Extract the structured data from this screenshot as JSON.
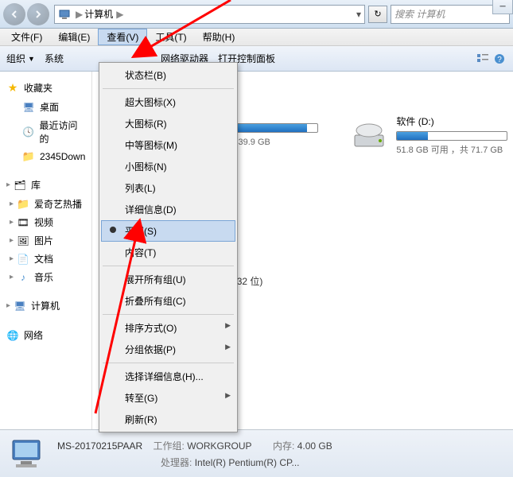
{
  "address": {
    "location": "计算机",
    "sep": "▶"
  },
  "search": {
    "placeholder": "搜索 计算机"
  },
  "menubar": {
    "file": "文件(F)",
    "edit": "编辑(E)",
    "view": "查看(V)",
    "tools": "工具(T)",
    "help": "帮助(H)"
  },
  "toolbar": {
    "organize": "组织",
    "system": "系统",
    "map_drive": "网络驱动器",
    "control_panel": "打开控制面板"
  },
  "sidebar": {
    "favorites": "收藏夹",
    "fav_items": [
      "桌面",
      "最近访问的",
      "2345Down"
    ],
    "libraries": "库",
    "lib_items": [
      "爱奇艺热播",
      "视频",
      "图片",
      "文档",
      "音乐"
    ],
    "computer": "计算机",
    "network": "网络"
  },
  "dropdown": {
    "status_bar": "状态栏(B)",
    "extra_large": "超大图标(X)",
    "large": "大图标(R)",
    "medium": "中等图标(M)",
    "small": "小图标(N)",
    "list": "列表(L)",
    "details": "详细信息(D)",
    "tiles": "平铺(S)",
    "content": "内容(T)",
    "expand_all": "展开所有组(U)",
    "collapse_all": "折叠所有组(C)",
    "sort_by": "排序方式(O)",
    "group_by": "分组依据(P)",
    "choose_details": "选择详细信息(H)...",
    "goto": "转至(G)",
    "refresh": "刷新(R)"
  },
  "drives": [
    {
      "name": "",
      "free_text": "用 ，共 39.9 GB",
      "fill_percent": 90
    },
    {
      "name": "软件 (D:)",
      "free_text": "51.8 GB 可用 ，共 71.7 GB",
      "fill_percent": 28
    }
  ],
  "section_video": "视频 (32 位)",
  "details": {
    "computer_name": "MS-20170215PAAR",
    "workgroup_label": "工作组:",
    "workgroup": "WORKGROUP",
    "memory_label": "内存:",
    "memory": "4.00 GB",
    "processor_label": "处理器:",
    "processor": "Intel(R) Pentium(R) CP..."
  }
}
